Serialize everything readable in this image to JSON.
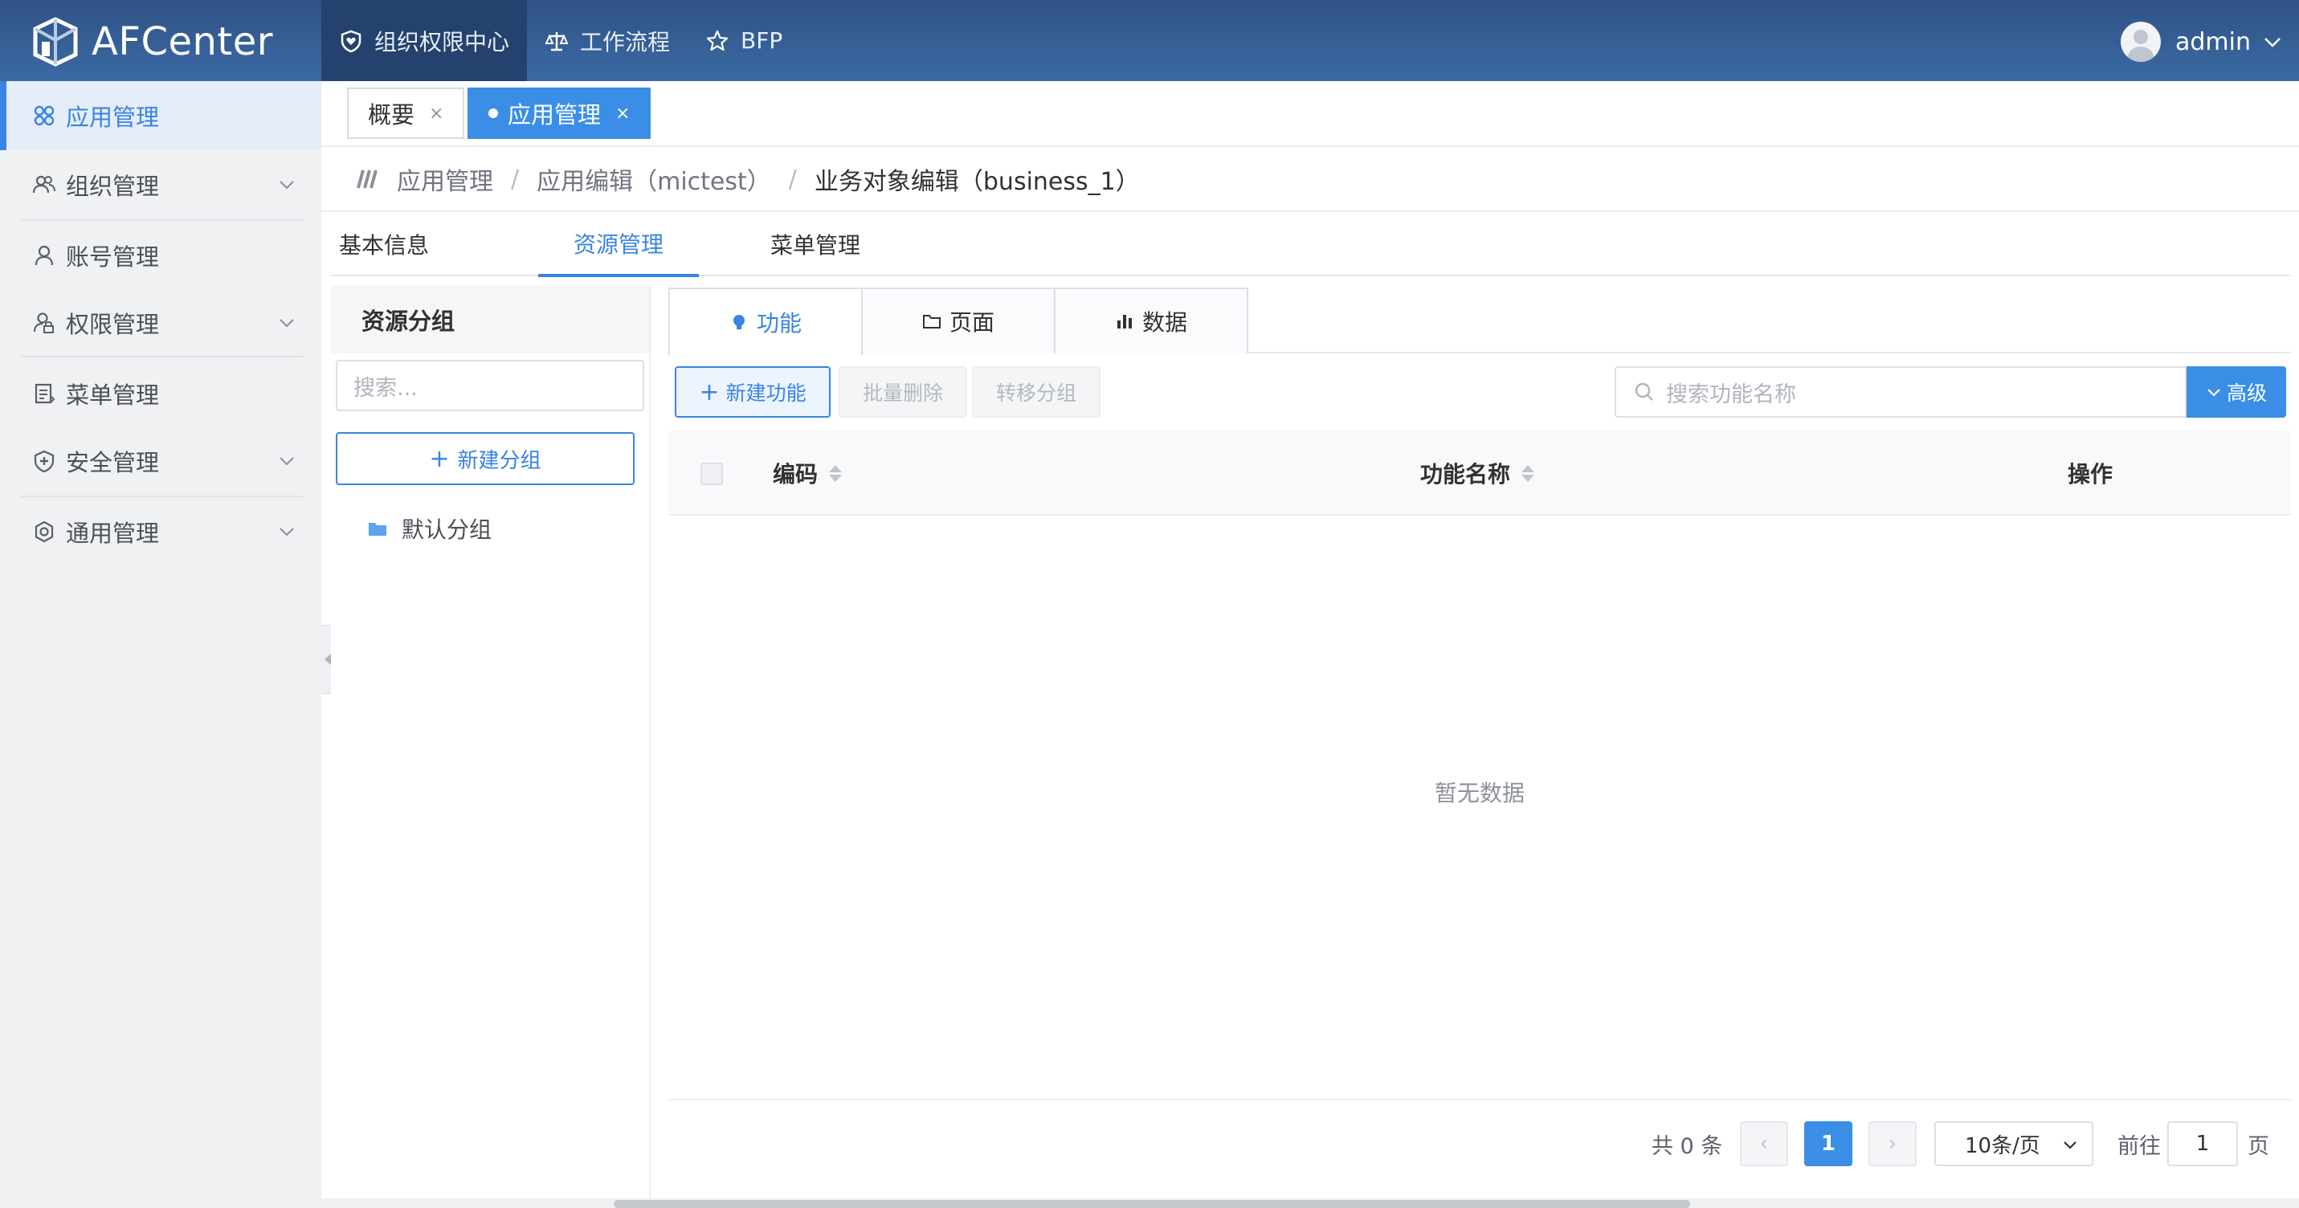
{
  "app": {
    "name": "AFCenter"
  },
  "topnav": {
    "items": [
      {
        "label": "组织权限中心",
        "icon": "shield-heart-icon",
        "active": true
      },
      {
        "label": "工作流程",
        "icon": "scale-icon",
        "active": false
      },
      {
        "label": "BFP",
        "icon": "star-icon",
        "active": false
      }
    ]
  },
  "user": {
    "name": "admin"
  },
  "sidebar": {
    "items": [
      {
        "label": "应用管理",
        "icon": "grid-icon",
        "active": true
      },
      {
        "label": "组织管理",
        "icon": "users-icon",
        "expandable": true
      },
      {
        "label": "账号管理",
        "icon": "user-icon"
      },
      {
        "label": "权限管理",
        "icon": "user-lock-icon",
        "expandable": true
      },
      {
        "label": "菜单管理",
        "icon": "menu-doc-icon"
      },
      {
        "label": "安全管理",
        "icon": "shield-plus-icon",
        "expandable": true
      },
      {
        "label": "通用管理",
        "icon": "settings-icon",
        "expandable": true
      }
    ]
  },
  "page_tabs": [
    {
      "label": "概要",
      "close": "×",
      "active": false
    },
    {
      "label": "应用管理",
      "close": "×",
      "active": true
    }
  ],
  "breadcrumb": [
    "应用管理",
    "应用编辑（mictest）",
    "业务对象编辑（business_1）"
  ],
  "breadcrumb_sep": "/",
  "subtabs": [
    {
      "label": "基本信息",
      "active": false
    },
    {
      "label": "资源管理",
      "active": true
    },
    {
      "label": "菜单管理",
      "active": false
    }
  ],
  "groups": {
    "title": "资源分组",
    "search_placeholder": "搜索...",
    "new_label": "新建分组",
    "plus": "+",
    "items": [
      "默认分组"
    ]
  },
  "type_tabs": [
    {
      "label": "功能",
      "icon": "bulb-icon",
      "active": true
    },
    {
      "label": "页面",
      "icon": "folder-icon",
      "active": false
    },
    {
      "label": "数据",
      "icon": "bar-chart-icon",
      "active": false
    }
  ],
  "toolbar": {
    "new_label": "新建功能",
    "plus": "+",
    "batch_delete_label": "批量删除",
    "move_group_label": "转移分组",
    "search_placeholder": "搜索功能名称",
    "advanced_label": "高级"
  },
  "table": {
    "columns": [
      "编码",
      "功能名称",
      "操作"
    ],
    "empty_text": "暂无数据"
  },
  "pagination": {
    "total_text": "共 0 条",
    "current_page": "1",
    "prev": "‹",
    "next": "›",
    "page_size": "10条/页",
    "goto_label": "前往",
    "goto_value": "1",
    "goto_unit": "页"
  },
  "colors": {
    "primary": "#3a8ee6",
    "navbar": "#2f5286",
    "sidebar_bg": "#f0f1f3"
  }
}
